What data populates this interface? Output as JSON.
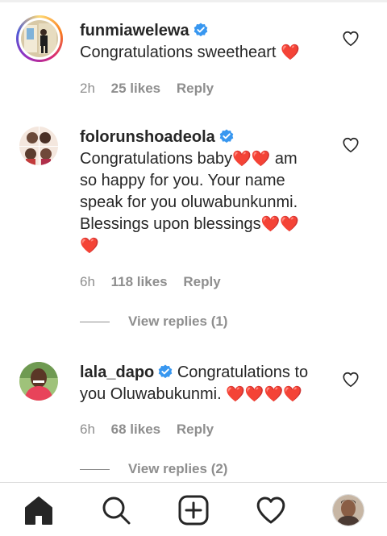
{
  "comments": [
    {
      "username": "funmiawelewa",
      "text": "Congratulations sweetheart",
      "hearts": "❤️",
      "time": "2h",
      "likes": "25 likes",
      "reply": "Reply",
      "verified": true
    },
    {
      "username": "folorunshoadeola",
      "text_line1": "Congratulations baby",
      "hearts1": "❤️❤️",
      "text_line1b": " am",
      "text_line2": "so happy for you. Your name",
      "text_line3": "speak for you oluwabunkunmi.",
      "text_line4": "Blessings upon blessings",
      "hearts2": "❤️❤️",
      "hearts3": "❤️",
      "time": "6h",
      "likes": "118 likes",
      "reply": "Reply",
      "view_replies": "View replies (1)",
      "verified": true
    },
    {
      "username": "lala_dapo",
      "text_line1": "Congratulations to",
      "text_line2": "you Oluwabukunmi.",
      "hearts": "❤️❤️❤️❤️",
      "time": "6h",
      "likes": "68 likes",
      "reply": "Reply",
      "view_replies": "View replies (2)",
      "verified": true
    }
  ],
  "nav": {
    "items": [
      "home-icon",
      "search-icon",
      "new-post-icon",
      "activity-icon",
      "profile-avatar"
    ]
  },
  "colors": {
    "verified": "#3897f0",
    "heart": "#e0142b",
    "meta": "#8e8e8e"
  }
}
